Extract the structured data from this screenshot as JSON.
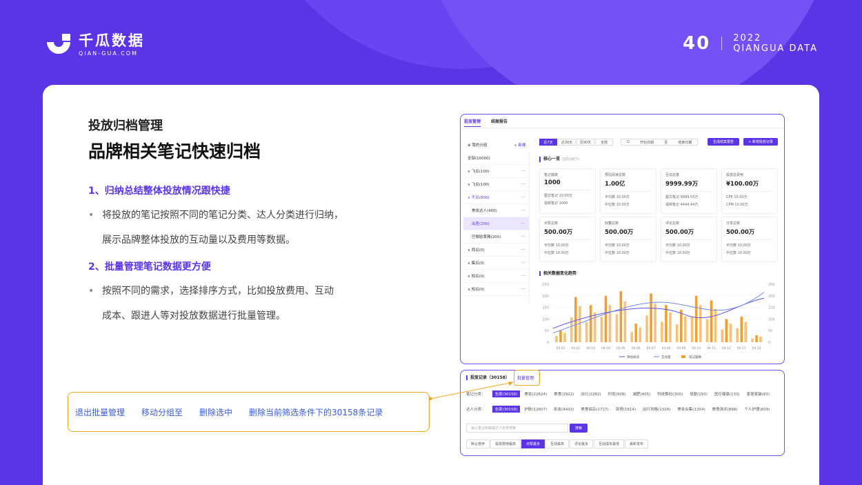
{
  "brand": {
    "name_cn": "千瓜数据",
    "name_en": "QIAN-GUA.COM"
  },
  "page": {
    "number": "40",
    "year": "2022",
    "tag": "QIANGUA DATA"
  },
  "content": {
    "subtitle": "投放归档管理",
    "title": "品牌相关笔记快速归档",
    "points": [
      {
        "heading": "1、归纳总结整体投放情况跟快捷",
        "lines": [
          "将投放的笔记按照不同的笔记分类、达人分类进行归纳，",
          "展示品牌整体投放的互动量以及费用等数据。"
        ]
      },
      {
        "heading": "2、批量管理笔记数据更方便",
        "lines": [
          "按照不同的需求，选择排序方式，比如投放费用、互动",
          "成本、跟进人等对投放数据进行批量管理。"
        ]
      }
    ]
  },
  "callout": [
    "退出批量管理",
    "移动分组至",
    "删除选中",
    "删除当前筛选条件下的30158条记录"
  ],
  "app": {
    "tabs": [
      "投放管理",
      "结案报告"
    ],
    "side_header": "我的分组",
    "side_new": "+ 新建",
    "side_items": [
      "全部(10000)",
      "飞瓜(100)",
      "飞瓜(100)",
      "千瓜(800)",
      "美妆达人(400)",
      "出差(200)",
      "巴黎欧莱雅(200)",
      "西瓜(0)",
      "集瓜(0)",
      "知瓜(0)",
      "知瓜(0)"
    ],
    "filters": [
      "近7天",
      "近30天",
      "近90天",
      "全部"
    ],
    "date_from": "开始日期",
    "date_to": "结束日期",
    "btn_report": "生成结案报告",
    "btn_add": "+ 新增投放记录",
    "core": "核心一览",
    "core_note": "(当前分组下)",
    "metrics": [
      {
        "label": "笔记篇数",
        "value": "1000",
        "l1": "图文笔记 10.00万",
        "l2": "视频笔记 1000"
      },
      {
        "label": "预估阅读总数",
        "value": "1.00亿",
        "l1": "平均数 10.00万",
        "l2": "中位数 10.00万"
      },
      {
        "label": "互动总量",
        "value": "9999.99万",
        "l1": "图文笔记 9999.55万",
        "l2": "视频笔记 4444.44万"
      },
      {
        "label": "投放总费用",
        "value": "¥100.00万",
        "l1": "CPE 10.00万",
        "l2": "CPM 10.00万"
      },
      {
        "label": "点赞总数",
        "value": "500.00万",
        "l1": "平均数 10.00万",
        "l2": "中位数 10.00万"
      },
      {
        "label": "收藏总数",
        "value": "500.00万",
        "l1": "平均数 10.00万",
        "l2": "中位数 10.00万"
      },
      {
        "label": "评论总数",
        "value": "500.00万",
        "l1": "平均数 10.00万",
        "l2": "中位数 10.00万"
      },
      {
        "label": "分享总数",
        "value": "500.00万",
        "l1": "平均数 10.00万",
        "l2": "中位数 10.00万"
      }
    ],
    "trend_title": "相关数据变化趋势",
    "record_title": "投放记录（30158）",
    "batch": "批量管理",
    "note_cat_label": "笔记分类：",
    "note_cats": [
      "全部(30158)",
      "美妆(22624)",
      "美食(2922)",
      "出行(2282)",
      "时尚(908)",
      "减肥(405)",
      "科技数码(300)",
      "母婴(193)",
      "医疗健康(133)",
      "家居家装(83)"
    ],
    "kol_cat_label": "达人分类：",
    "kol_cats": [
      "全部(30158)",
      "护肤(12607)",
      "彩妆(4432)",
      "美食探店(1717)",
      "穿搭(1814)",
      "出行攻略(1324)",
      "美妆合集(1354)",
      "美食测评(898)",
      "个人护理(609)"
    ],
    "search_ph": "输入笔记标题或达人名称搜索",
    "search_btn": "搜索",
    "sorts": [
      "默认排序",
      "投放费用最高",
      "点赞最多",
      "互动最高",
      "评论最多",
      "互动成本最低",
      "最新发布"
    ]
  },
  "chart_data": {
    "type": "bar",
    "categories": [
      "04.01",
      "04.02",
      "04.03",
      "04.04",
      "04.05",
      "04.06",
      "04.07",
      "04.08",
      "04.09",
      "04.10",
      "04.11",
      "04.12",
      "04.13",
      "04.14"
    ],
    "series": [
      {
        "name": "笔记篇数",
        "type": "bar",
        "values": [
          50,
          195,
          160,
          200,
          220,
          80,
          210,
          160,
          140,
          200,
          180,
          100,
          110,
          30
        ]
      },
      {
        "name": "预估阅读",
        "type": "line"
      },
      {
        "name": "互动量",
        "type": "line"
      }
    ],
    "ylim": [
      0,
      250
    ],
    "yticks": [
      0,
      50,
      100,
      150,
      200,
      250
    ],
    "legend": "bottom",
    "colors": {
      "bar": "#f0a030",
      "line1": "#5b4ff0",
      "line2": "#6a8af0"
    }
  }
}
